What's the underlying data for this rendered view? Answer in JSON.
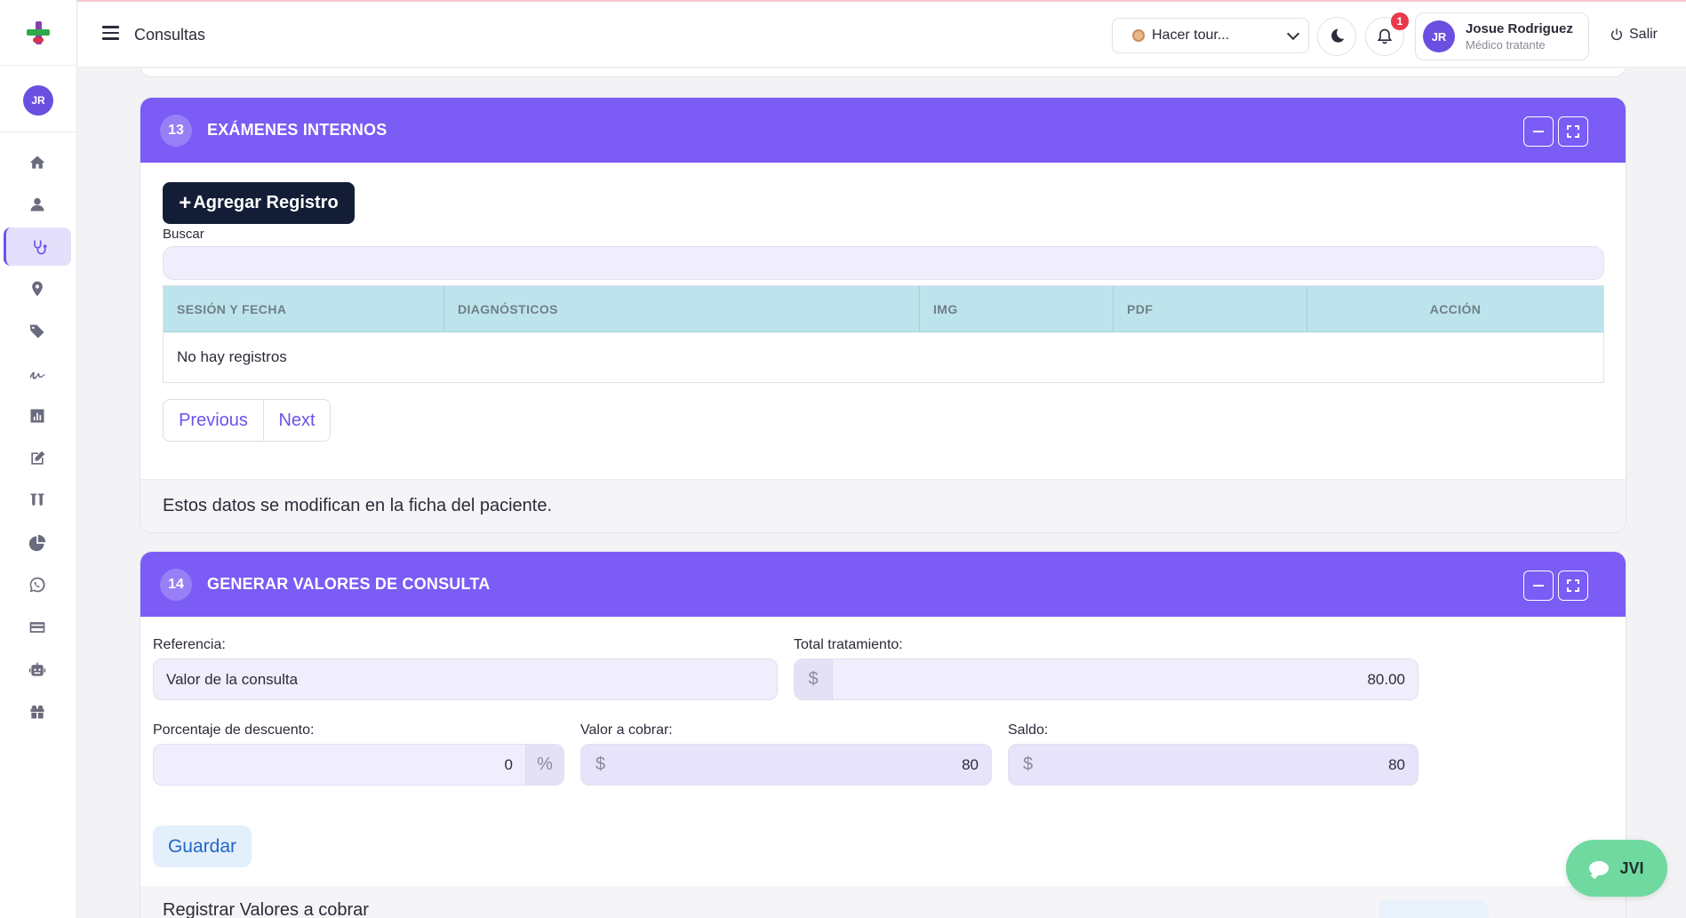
{
  "header": {
    "page_title": "Consultas",
    "tour_label": "Hacer tour...",
    "notifications_count": "1",
    "user_initials": "JR",
    "user_name": "Josue Rodriguez",
    "user_role": "Médico tratante",
    "logout_label": "Salir"
  },
  "sidebar": {
    "avatar_initials": "JR",
    "items": [
      {
        "icon": "home-icon"
      },
      {
        "icon": "user-icon"
      },
      {
        "icon": "stethoscope-icon",
        "active": true
      },
      {
        "icon": "map-pin-icon"
      },
      {
        "icon": "tags-icon"
      },
      {
        "icon": "signature-icon"
      },
      {
        "icon": "bar-chart-icon"
      },
      {
        "icon": "edit-icon"
      },
      {
        "icon": "test-tubes-icon"
      },
      {
        "icon": "pie-chart-icon"
      },
      {
        "icon": "whatsapp-icon"
      },
      {
        "icon": "credit-card-icon"
      },
      {
        "icon": "robot-icon"
      },
      {
        "icon": "gift-icon"
      }
    ]
  },
  "examenes": {
    "number": "13",
    "title": "EXÁMENES INTERNOS",
    "add_label": "Agregar Registro",
    "search_label": "Buscar",
    "search_value": "",
    "columns": [
      "SESIÓN Y FECHA",
      "DIAGNÓSTICOS",
      "IMG",
      "PDF",
      "ACCIÓN"
    ],
    "empty_message": "No hay registros",
    "prev_label": "Previous",
    "next_label": "Next",
    "footer_note": "Estos datos se modifican en la ficha del paciente."
  },
  "valores": {
    "number": "14",
    "title": "GENERAR VALORES DE CONSULTA",
    "referencia_label": "Referencia:",
    "referencia_value": "Valor de la consulta",
    "total_label": "Total tratamiento:",
    "total_value": "80.00",
    "descuento_label": "Porcentaje de descuento:",
    "descuento_value": "0",
    "cobrar_label": "Valor a cobrar:",
    "cobrar_value": "80",
    "saldo_label": "Saldo:",
    "saldo_value": "80",
    "currency_symbol": "$",
    "percent_symbol": "%",
    "save_label": "Guardar",
    "register_label": "Registrar Valores a cobrar"
  },
  "chat": {
    "label": "JVI"
  },
  "colors": {
    "accent": "#7b5cf5",
    "table_header": "#bde4ec",
    "primary_dark": "#131e36",
    "chat_bubble": "#6fd9a0"
  }
}
